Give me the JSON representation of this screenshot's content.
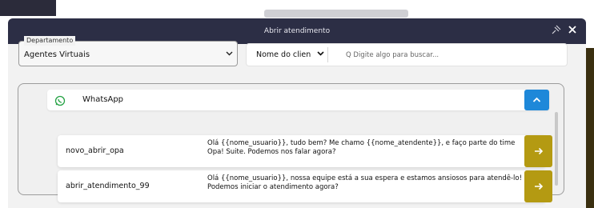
{
  "modal": {
    "title": "Abrir atendimento"
  },
  "department": {
    "legend": "Departamento",
    "value": "Agentes Virtuais"
  },
  "search": {
    "filter_value": "Nome do clien",
    "placeholder": "Q Digite algo para buscar..."
  },
  "channel": {
    "label": "WhatsApp",
    "icon": "whatsapp-icon"
  },
  "templates": [
    {
      "name": "novo_abrir_opa",
      "message": "Olá {{nome_usuario}}, tudo bem? Me chamo {{nome_atendente}}, e faço parte do time Opa! Suite. Podemos nos falar agora?"
    },
    {
      "name": "abrir_atendimento_99",
      "message": "Olá {{nome_usuario}}, nossa equipe está a sua espera e estamos ansiosos para atendê-lo! Podemos iniciar o atendimento agora?"
    }
  ],
  "colors": {
    "header": "#2c2e45",
    "collapse_button": "#1e88d9",
    "send_button": "#b49a12",
    "whatsapp": "#25a244"
  }
}
